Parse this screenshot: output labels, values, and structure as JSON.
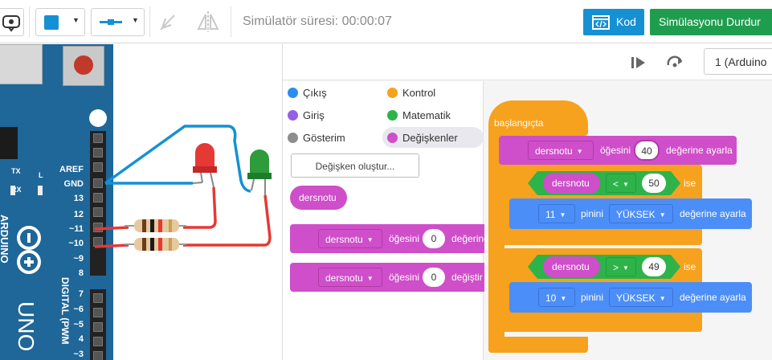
{
  "toolbar": {
    "sim_time_label": "Simülatör süresi: 00:00:07",
    "kod_label": "Kod",
    "stop_sim_label": "Simülasyonu Durdur",
    "color_value": "#1591d3"
  },
  "circuit": {
    "pins": [
      "AREF",
      "GND",
      "13",
      "12",
      "~11",
      "~10",
      "~9",
      "8",
      "7",
      "~6",
      "~5",
      "4",
      "~3"
    ],
    "pins_left": [
      "TX",
      "RX",
      "L"
    ],
    "board_brand": "ARDUINO",
    "board_model": "UNO",
    "digital_label": "DIGITAL (PWM"
  },
  "code": {
    "board_select": "1 (Arduino",
    "categories": [
      {
        "label": "Çıkış",
        "color": "#2d8cf0"
      },
      {
        "label": "Kontrol",
        "color": "#f6a21e"
      },
      {
        "label": "Giriş",
        "color": "#9260e6"
      },
      {
        "label": "Matematik",
        "color": "#2db34a"
      },
      {
        "label": "Gösterim",
        "color": "#8d8d8d"
      },
      {
        "label": "Değişkenler",
        "color": "#cf4ec9"
      }
    ],
    "create_variable": "Değişken oluştur...",
    "variable_name": "dersnotu",
    "palette_block1": {
      "var": "dersnotu",
      "text": "öğesini",
      "value": "0",
      "suffix": "değerine"
    },
    "palette_block2": {
      "var": "dersnotu",
      "text": "öğesini",
      "value": "0",
      "suffix": "değiştir"
    },
    "workspace": {
      "hat": "başlangıçta",
      "set_block": {
        "var": "dersnotu",
        "text": "öğesini",
        "value": "40",
        "suffix": "değerine ayarla"
      },
      "if1": {
        "var": "dersnotu",
        "op": "<",
        "value": "50",
        "suffix": "ise"
      },
      "pin1": {
        "pin": "11",
        "text": "pinini",
        "level": "YÜKSEK",
        "suffix": "değerine ayarla"
      },
      "if2": {
        "var": "dersnotu",
        "op": ">",
        "value": "49",
        "suffix": "ise"
      },
      "pin2": {
        "pin": "10",
        "text": "pinini",
        "level": "YÜKSEK",
        "suffix": "değerine ayarla"
      }
    }
  }
}
